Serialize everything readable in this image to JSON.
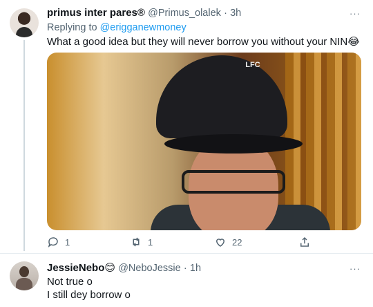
{
  "tweet": {
    "display_name": "primus inter pares",
    "registered_mark": "®",
    "handle": "@Primus_olalek",
    "time": "3h",
    "separator": "·",
    "replying_prefix": "Replying to",
    "replying_mention": "@erigganewmoney",
    "text": "What a good idea but they will never borrow you without your NIN😂",
    "media_logo": "LFC",
    "actions": {
      "reply_count": "1",
      "retweet_count": "1",
      "like_count": "22"
    }
  },
  "reply": {
    "display_name": "JessieNebo",
    "emoji": "😊",
    "handle": "@NeboJessie",
    "time": "1h",
    "separator": "·",
    "lines": [
      "Not true o",
      "I still dey borrow o"
    ]
  },
  "more_icon": "···",
  "colors": {
    "accent": "#1d9bf0",
    "muted": "#536471",
    "text": "#0f1419",
    "divider": "#e6ecf0"
  },
  "icons": [
    "more-icon",
    "reply-icon",
    "retweet-icon",
    "like-icon",
    "share-icon"
  ]
}
